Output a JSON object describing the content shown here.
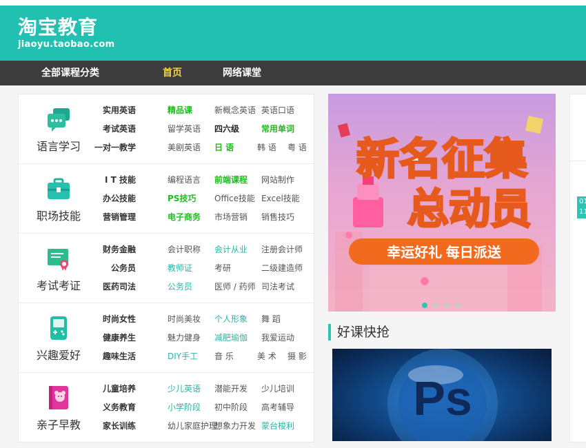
{
  "logo": {
    "title": "淘宝教育",
    "url": "jiaoyu.taobao.com"
  },
  "nav": {
    "categories": "全部课程分类",
    "home": "首页",
    "online": "网络课堂"
  },
  "categories": [
    {
      "title": "语言学习",
      "icon": "chat-bubble-icon",
      "lines": [
        [
          {
            "t": "实用英语",
            "s": "head"
          },
          {
            "t": "精品课",
            "s": "green"
          },
          {
            "t": "新概念英语",
            "s": ""
          },
          {
            "t": "英语口语",
            "s": ""
          }
        ],
        [
          {
            "t": "考试英语",
            "s": "head"
          },
          {
            "t": "留学英语",
            "s": ""
          },
          {
            "t": "四六级",
            "s": "bold"
          },
          {
            "t": "常用单词",
            "s": "green"
          }
        ],
        [
          {
            "t": "一对一教学",
            "s": "head"
          },
          {
            "t": "美剧英语",
            "s": ""
          },
          {
            "t": "日 语",
            "s": "green"
          },
          {
            "t": "韩 语",
            "s": ""
          },
          {
            "t": "粤 语",
            "s": ""
          }
        ]
      ]
    },
    {
      "title": "职场技能",
      "icon": "briefcase-icon",
      "lines": [
        [
          {
            "t": "I T 技能",
            "s": "head"
          },
          {
            "t": "编程语言",
            "s": ""
          },
          {
            "t": "前端课程",
            "s": "green"
          },
          {
            "t": "网站制作",
            "s": ""
          }
        ],
        [
          {
            "t": "办公技能",
            "s": "head"
          },
          {
            "t": "PS技巧",
            "s": "green"
          },
          {
            "t": "Office技能",
            "s": ""
          },
          {
            "t": "Excel技能",
            "s": ""
          }
        ],
        [
          {
            "t": "营销管理",
            "s": "head"
          },
          {
            "t": "电子商务",
            "s": "green"
          },
          {
            "t": "市场营销",
            "s": ""
          },
          {
            "t": "销售技巧",
            "s": ""
          }
        ]
      ]
    },
    {
      "title": "考试考证",
      "icon": "certificate-icon",
      "lines": [
        [
          {
            "t": "财务金融",
            "s": "head"
          },
          {
            "t": "会计职称",
            "s": ""
          },
          {
            "t": "会计从业",
            "s": "teal"
          },
          {
            "t": "注册会计师",
            "s": ""
          }
        ],
        [
          {
            "t": "公务员",
            "s": "head"
          },
          {
            "t": "教师证",
            "s": "teal"
          },
          {
            "t": "考研",
            "s": ""
          },
          {
            "t": "二级建造师",
            "s": ""
          }
        ],
        [
          {
            "t": "医药司法",
            "s": "head"
          },
          {
            "t": "公务员",
            "s": "teal"
          },
          {
            "t": "医师 / 药师",
            "s": ""
          },
          {
            "t": "司法考试",
            "s": ""
          }
        ]
      ]
    },
    {
      "title": "兴趣爱好",
      "icon": "gameboy-icon",
      "lines": [
        [
          {
            "t": "时尚女性",
            "s": "head"
          },
          {
            "t": "时尚美妆",
            "s": ""
          },
          {
            "t": "个人形象",
            "s": "teal"
          },
          {
            "t": "舞 蹈",
            "s": ""
          }
        ],
        [
          {
            "t": "健康养生",
            "s": "head"
          },
          {
            "t": "魅力健身",
            "s": ""
          },
          {
            "t": "减肥瑜伽",
            "s": "teal"
          },
          {
            "t": "我爱运动",
            "s": ""
          }
        ],
        [
          {
            "t": "趣味生活",
            "s": "head"
          },
          {
            "t": "DIY手工",
            "s": "teal"
          },
          {
            "t": "音 乐",
            "s": ""
          },
          {
            "t": "美 术",
            "s": ""
          },
          {
            "t": "摄 影",
            "s": ""
          }
        ]
      ]
    },
    {
      "title": "亲子早教",
      "icon": "baby-book-icon",
      "lines": [
        [
          {
            "t": "儿童培养",
            "s": "head"
          },
          {
            "t": "少儿英语",
            "s": "teal"
          },
          {
            "t": "潜能开发",
            "s": ""
          },
          {
            "t": "少儿培训",
            "s": ""
          }
        ],
        [
          {
            "t": "义务教育",
            "s": "head"
          },
          {
            "t": "小学阶段",
            "s": "teal"
          },
          {
            "t": "初中阶段",
            "s": ""
          },
          {
            "t": "高考辅导",
            "s": ""
          }
        ],
        [
          {
            "t": "家长训练",
            "s": "head"
          },
          {
            "t": "幼儿家庭护理",
            "s": ""
          },
          {
            "t": "想象力开发",
            "s": ""
          },
          {
            "t": "蒙台梭利",
            "s": "teal"
          }
        ]
      ]
    }
  ],
  "banner": {
    "line1": "新名征集",
    "line2": "总动员",
    "ribbon": "幸运好礼 每日派送"
  },
  "section": {
    "title": "好课快抢"
  },
  "course": {
    "logo": "Ps"
  },
  "side": {
    "tag": "01 11"
  },
  "colors": {
    "brand": "#22c0b0",
    "nav_bg": "#3c3c3c",
    "nav_active": "#f3d24a",
    "green": "#1bbf1b",
    "teal": "#2bb5a6"
  }
}
